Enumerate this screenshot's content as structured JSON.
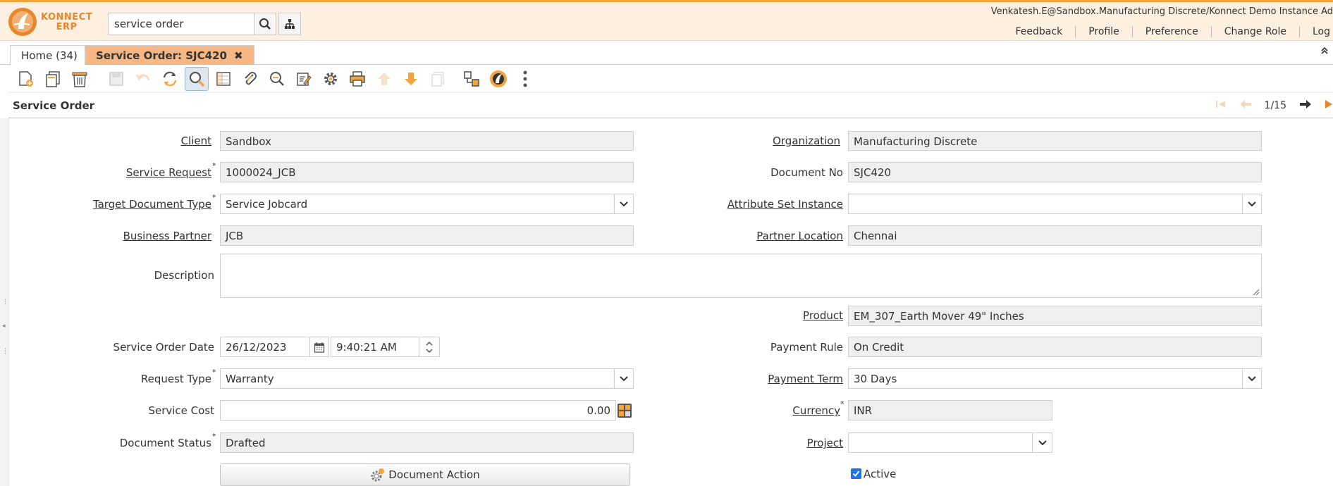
{
  "header": {
    "logo_line1": "KONNECT",
    "logo_line2": "ERP",
    "search_value": "service order",
    "user_info": "Venkatesh.E@Sandbox.Manufacturing Discrete/Konnect Demo Instance Ad",
    "links": [
      "Feedback",
      "Profile",
      "Preference",
      "Change Role",
      "Log"
    ]
  },
  "tabs": [
    {
      "label": "Home (34)"
    },
    {
      "label": "Service Order: SJC420"
    }
  ],
  "tab_close_glyph": "✖",
  "window": {
    "title": "Service Order",
    "record_position": "1/15"
  },
  "form": {
    "client": {
      "label": "Client",
      "value": "Sandbox"
    },
    "organization": {
      "label": "Organization",
      "value": "Manufacturing Discrete"
    },
    "service_request": {
      "label": "Service Request",
      "value": "1000024_JCB"
    },
    "document_no": {
      "label": "Document No",
      "value": "SJC420"
    },
    "target_document_type": {
      "label": "Target Document Type",
      "value": "Service Jobcard"
    },
    "attribute_set_instance": {
      "label": "Attribute Set Instance",
      "value": ""
    },
    "business_partner": {
      "label": "Business Partner",
      "value": "JCB"
    },
    "partner_location": {
      "label": "Partner Location",
      "value": "Chennai"
    },
    "description": {
      "label": "Description",
      "value": ""
    },
    "product": {
      "label": "Product",
      "value": "EM_307_Earth Mover 49\" Inches"
    },
    "service_order_date": {
      "label": "Service Order Date",
      "date": "26/12/2023",
      "time": "9:40:21 AM"
    },
    "payment_rule": {
      "label": "Payment Rule",
      "value": "On Credit"
    },
    "request_type": {
      "label": "Request Type",
      "value": "Warranty"
    },
    "payment_term": {
      "label": "Payment Term",
      "value": "30 Days"
    },
    "service_cost": {
      "label": "Service Cost",
      "value": "0.00"
    },
    "currency": {
      "label": "Currency",
      "value": "INR"
    },
    "document_status": {
      "label": "Document Status",
      "value": "Drafted"
    },
    "project": {
      "label": "Project",
      "value": ""
    },
    "document_action": {
      "label": "Document Action"
    },
    "active": {
      "label": "Active",
      "checked": true
    }
  },
  "required_marker": "*",
  "colors": {
    "header_bg": "#fdf0e1",
    "accent": "#f5a33b",
    "active_tab": "#f6b784",
    "field_readonly": "#efefef"
  }
}
